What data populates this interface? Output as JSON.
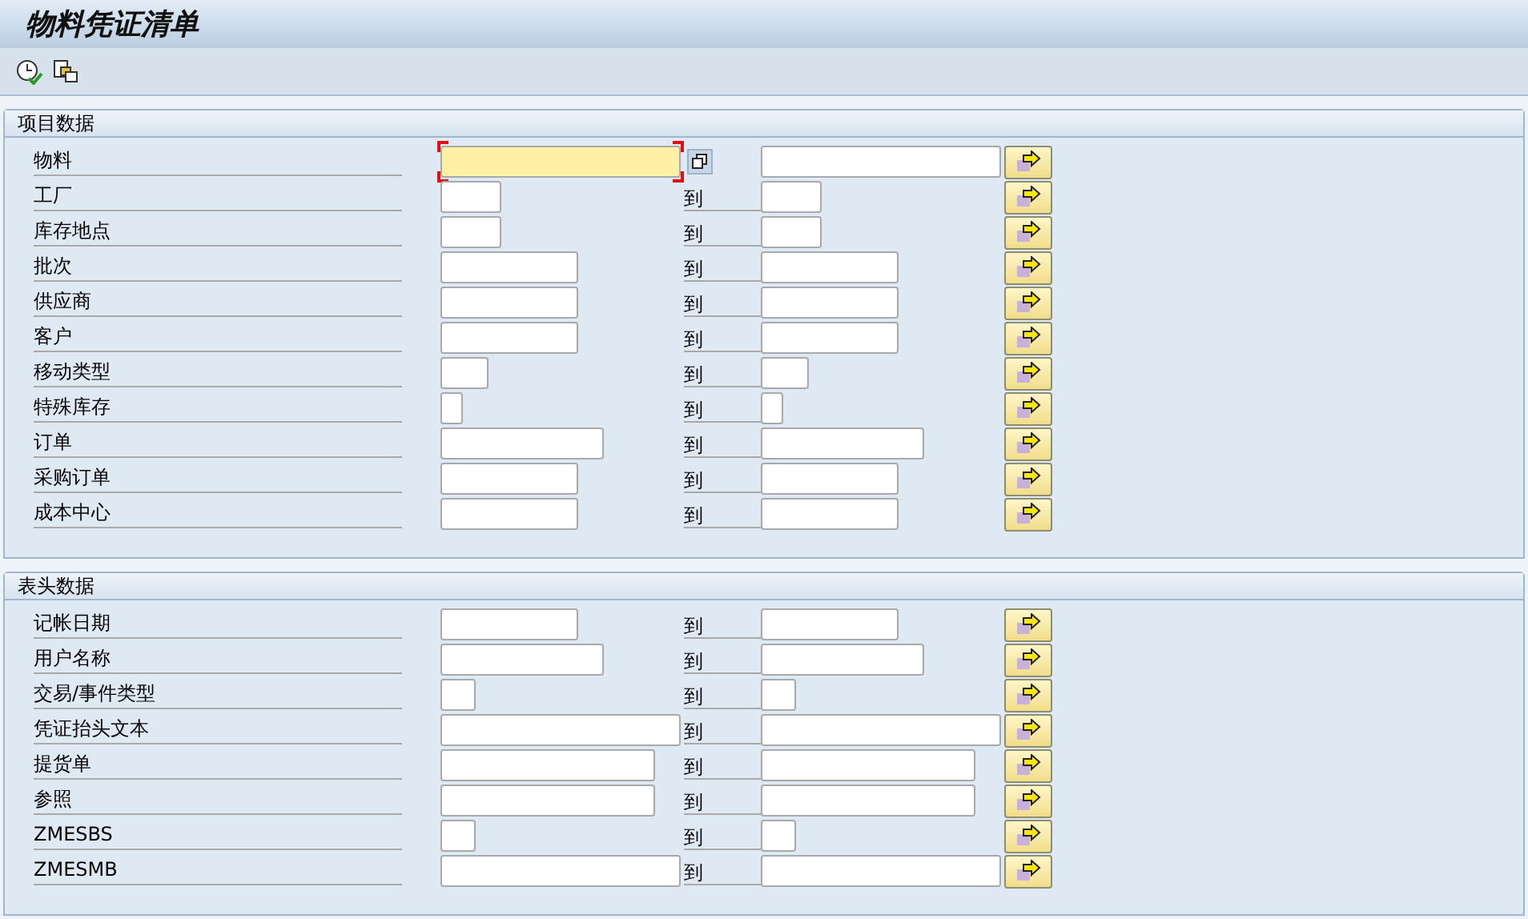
{
  "window": {
    "title": "物料凭证清单"
  },
  "toolbar": {
    "buttons": [
      {
        "kind": "execute"
      },
      {
        "kind": "variant"
      }
    ]
  },
  "groups": [
    {
      "title": "项目数据",
      "rows": [
        {
          "label": "物料",
          "focused": true
        },
        {
          "label": "工厂",
          "to": "到",
          "focused": false
        },
        {
          "label": "库存地点",
          "to": "到",
          "focused": false
        },
        {
          "label": "批次",
          "to": "到",
          "focused": false
        },
        {
          "label": "供应商",
          "to": "到",
          "focused": false
        },
        {
          "label": "客户",
          "to": "到",
          "focused": false
        },
        {
          "label": "移动类型",
          "to": "到",
          "focused": false
        },
        {
          "label": "特殊库存",
          "to": "到",
          "focused": false
        },
        {
          "label": "订单",
          "to": "到",
          "focused": false
        },
        {
          "label": "采购订单",
          "to": "到",
          "focused": false
        },
        {
          "label": "成本中心",
          "to": "到",
          "focused": false
        }
      ]
    },
    {
      "title": "表头数据",
      "rows": [
        {
          "label": "记帐日期",
          "to": "到",
          "focused": false
        },
        {
          "label": "用户名称",
          "to": "到",
          "focused": false
        },
        {
          "label": "交易/事件类型",
          "to": "到",
          "focused": false
        },
        {
          "label": "凭证抬头文本",
          "to": "到",
          "focused": false
        },
        {
          "label": "提货单",
          "to": "到",
          "focused": false
        },
        {
          "label": "参照",
          "to": "到",
          "focused": false
        },
        {
          "label": "ZMESBS",
          "to": "到",
          "focused": false
        },
        {
          "label": "ZMESMB",
          "to": "到",
          "focused": false
        }
      ]
    }
  ]
}
